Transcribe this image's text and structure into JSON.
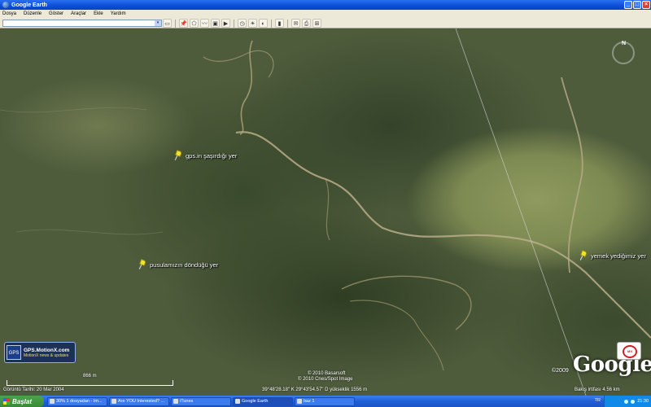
{
  "window": {
    "title": "Google Earth",
    "controls": [
      "_",
      "□",
      "×"
    ]
  },
  "menu": [
    "Dosya",
    "Düzenle",
    "Göster",
    "Araçlar",
    "Ekle",
    "Yardım"
  ],
  "toolbar": {
    "search_value": "",
    "icons": [
      "sidebar-icon",
      "placemark-icon",
      "polygon-icon",
      "path-icon",
      "overlay-icon",
      "tour-icon",
      "history-icon",
      "sun-icon",
      "planets-icon",
      "ruler-icon",
      "email-icon",
      "print-icon",
      "maps-icon"
    ]
  },
  "map": {
    "placemarks": [
      {
        "label": "gps.in şaşırdığı yer"
      },
      {
        "label": "pusulamızın döndüğü yer"
      },
      {
        "label": "yemek yediğimiz yer"
      }
    ],
    "gps_logo": {
      "title": "GPS.MotionX.com",
      "subtitle": "MotionX news & updates"
    },
    "copyright1": "© 2010 Basarsoft",
    "copyright2": "© 2010 Cnes/Spot Image",
    "imagery_date": "Görüntü Tarihi: 20 Mar 2004",
    "coords": "39°48'28.18\" K      29°43'54.57\" D  yükseklik  1556 m",
    "eye_alt": "Bakış irtifası    4.56 km",
    "scale": "866 m",
    "google_year": "©2009",
    "google_logo": "Google",
    "compass_n": "N"
  },
  "taskbar": {
    "start_label": "Başlat",
    "tasks": [
      {
        "label": "30% 1 dosyadan - Im..."
      },
      {
        "label": "Are YOU Interested? ..."
      },
      {
        "label": "iTunes"
      },
      {
        "label": "Google Earth"
      },
      {
        "label": "baz 1"
      }
    ],
    "lang": "TR",
    "clock": "21:30"
  }
}
